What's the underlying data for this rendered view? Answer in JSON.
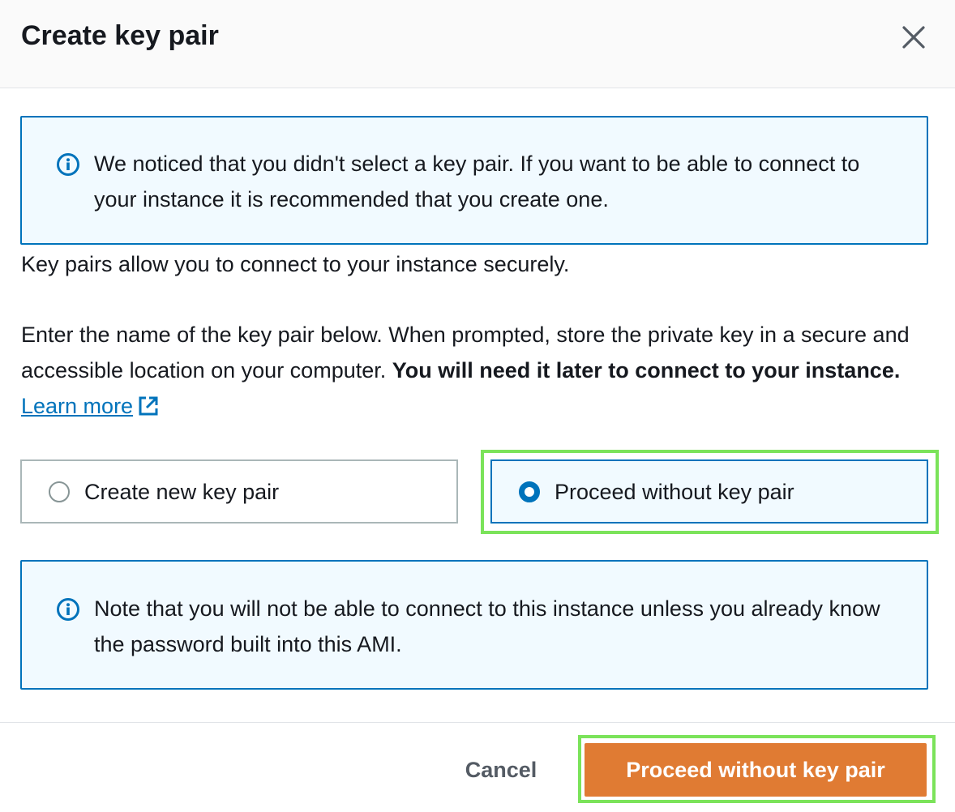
{
  "dialog": {
    "title": "Create key pair",
    "close_icon": "close-icon"
  },
  "info_top": {
    "icon": "info-icon",
    "text": "We noticed that you didn't select a key pair. If you want to be able to connect to your instance it is recommended that you create one."
  },
  "description": {
    "line1": "Key pairs allow you to connect to your instance securely.",
    "line2_plain": "Enter the name of the key pair below. When prompted, store the private key in a secure and accessible location on your computer. ",
    "line2_bold": "You will need it later to connect to your instance.",
    "learn_more": "Learn more",
    "external_icon": "external-link-icon"
  },
  "options": {
    "selected": "Proceed without key pair",
    "items": [
      {
        "label": "Create new key pair",
        "checked": false
      },
      {
        "label": "Proceed without key pair",
        "checked": true
      }
    ]
  },
  "info_bottom": {
    "icon": "info-icon",
    "text": "Note that you will not be able to connect to this instance unless you already know the password built into this AMI."
  },
  "footer": {
    "cancel_label": "Cancel",
    "primary_label": "Proceed without key pair"
  },
  "colors": {
    "accent_blue": "#0073bb",
    "info_bg": "#f1faff",
    "primary_orange": "#e07b33",
    "highlight_green": "#7be35a"
  }
}
